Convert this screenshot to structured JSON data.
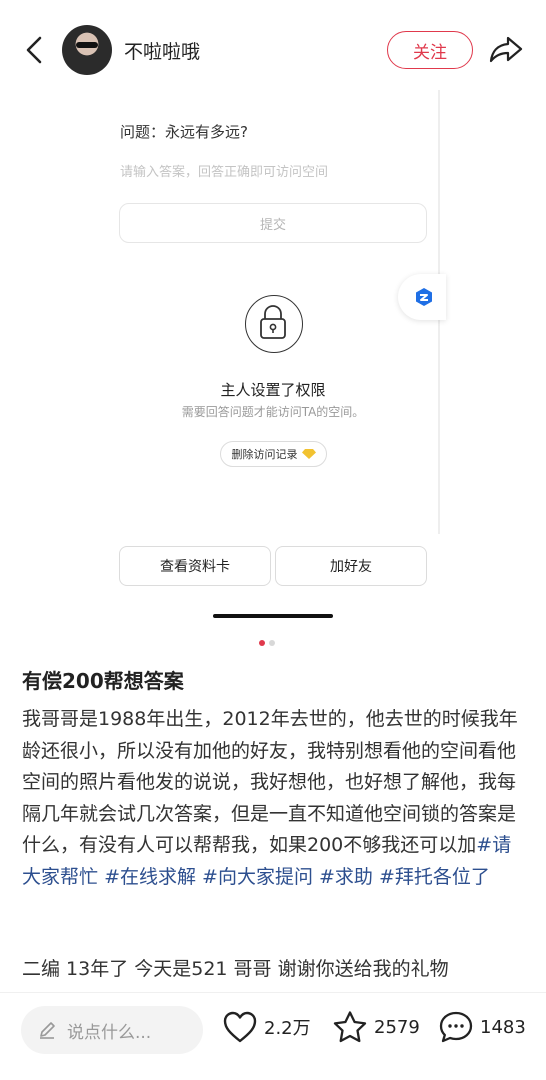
{
  "header": {
    "username": "不啦啦哦",
    "follow_label": "关注"
  },
  "card": {
    "question": "问题：永远有多远?",
    "answer_placeholder": "请输入答案，回答正确即可访问空间",
    "submit_label": "提交",
    "permission_title": "主人设置了权限",
    "permission_subtitle": "需要回答问题才能访问TA的空间。",
    "delete_history_label": "删除访问记录",
    "view_profile_label": "查看资料卡",
    "add_friend_label": "加好友"
  },
  "pager": {
    "current": 1,
    "total": 2
  },
  "post": {
    "title": "有偿200帮想答案",
    "body_text": "我哥哥是1988年出生，2012年去世的，他去世的时候我年龄还很小，所以没有加他的好友，我特别想看他的空间看他空间的照片看他发的说说，我好想他，也好想了解他，我每隔几年就会试几次答案，但是一直不知道他空间锁的答案是什么，有没有人可以帮帮我，如果200不够我还可以加",
    "tags": [
      "#请大家帮忙",
      "#在线求解",
      "#向大家提问",
      "#求助",
      "#拜托各位了"
    ],
    "extra_line": "二编 13年了 今天是521 哥哥 谢谢你送给我的礼物"
  },
  "bottom_bar": {
    "comment_placeholder": "说点什么...",
    "likes": "2.2万",
    "favorites": "2579",
    "comments": "1483"
  },
  "colors": {
    "accent": "#e0394c",
    "tag": "#2d4f8f",
    "placeholder": "#c4c4c4"
  },
  "icons": [
    "back-arrow-icon",
    "share-icon",
    "app-badge-icon",
    "lock-icon",
    "diamond-icon",
    "pencil-icon",
    "heart-icon",
    "star-icon",
    "comment-bubble-icon"
  ]
}
